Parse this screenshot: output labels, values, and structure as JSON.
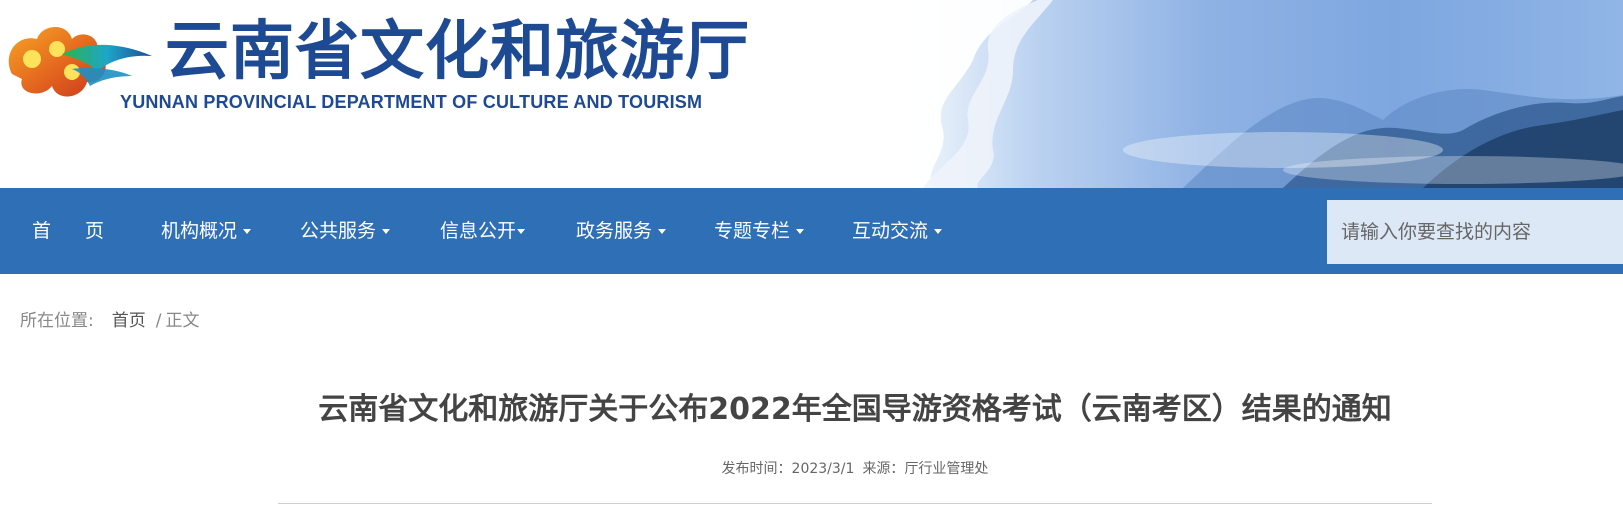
{
  "header": {
    "title": "云南省文化和旅游厅",
    "subtitle": "YUNNAN PROVINCIAL DEPARTMENT OF CULTURE AND TOURISM",
    "brand_color": "#1d4a93"
  },
  "nav": {
    "bg_color": "#2e6fb5",
    "home_label_1": "首",
    "home_label_2": "页",
    "items": [
      {
        "label": "机构概况"
      },
      {
        "label": "公共服务"
      },
      {
        "label": "信息公开"
      },
      {
        "label": "政务服务"
      },
      {
        "label": "专题专栏"
      },
      {
        "label": "互动交流"
      }
    ]
  },
  "search": {
    "placeholder": "请输入你要查找的内容",
    "value": ""
  },
  "breadcrumb": {
    "prefix": "所在位置:",
    "home": "首页",
    "separator": "/",
    "current": "正文"
  },
  "article": {
    "title": "云南省文化和旅游厅关于公布2022年全国导游资格考试（云南考区）结果的通知",
    "date_label": "发布时间：",
    "date": "2023/3/1",
    "source_label": "来源：",
    "source": "厅行业管理处"
  }
}
